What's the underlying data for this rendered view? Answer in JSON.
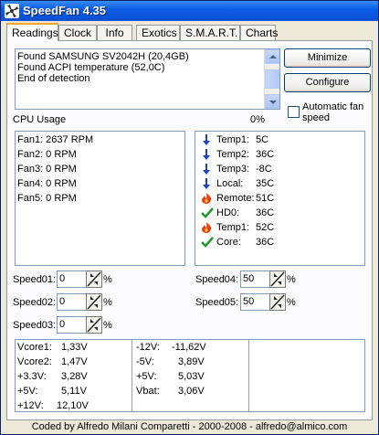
{
  "window": {
    "title": "SpeedFan 4.35"
  },
  "tabs": [
    "Readings",
    "Clock",
    "Info",
    "Exotics",
    "S.M.A.R.T.",
    "Charts"
  ],
  "log": {
    "lines": [
      "Found SAMSUNG SV2042H (20,4GB)",
      "Found ACPI temperature (52,0C)",
      "End of detection"
    ]
  },
  "buttons": {
    "minimize": "Minimize",
    "configure": "Configure"
  },
  "auto_fan": {
    "label_line1": "Automatic fan",
    "label_line2": "speed"
  },
  "cpu_usage": {
    "label": "CPU Usage",
    "value": "0%"
  },
  "fans": [
    "Fan1: 2637 RPM",
    "Fan2: 0 RPM",
    "Fan3: 0 RPM",
    "Fan4: 0 RPM",
    "Fan5: 0 RPM"
  ],
  "temps": [
    {
      "icon": "arrow-down-icon",
      "name": "Temp1:",
      "value": "5C"
    },
    {
      "icon": "arrow-down-icon",
      "name": "Temp2:",
      "value": "36C"
    },
    {
      "icon": "arrow-down-icon",
      "name": "Temp3:",
      "value": "-8C"
    },
    {
      "icon": "arrow-down-icon",
      "name": "Local:",
      "value": "35C"
    },
    {
      "icon": "flame-icon",
      "name": "Remote:",
      "value": "51C"
    },
    {
      "icon": "checkmark-icon",
      "name": "HD0:",
      "value": "36C"
    },
    {
      "icon": "flame-icon",
      "name": "Temp1:",
      "value": "52C"
    },
    {
      "icon": "checkmark-icon",
      "name": "Core:",
      "value": "36C"
    }
  ],
  "speeds": {
    "speed01": {
      "label": "Speed01:",
      "value": "0",
      "unit": "%"
    },
    "speed02": {
      "label": "Speed02:",
      "value": "0",
      "unit": "%"
    },
    "speed03": {
      "label": "Speed03:",
      "value": "0",
      "unit": "%"
    },
    "speed04": {
      "label": "Speed04:",
      "value": "50",
      "unit": "%"
    },
    "speed05": {
      "label": "Speed05:",
      "value": "50",
      "unit": "%"
    }
  },
  "voltages": {
    "col1": [
      {
        "name": "Vcore1:",
        "value": "1,33V"
      },
      {
        "name": "Vcore2:",
        "value": "1,47V"
      },
      {
        "name": "+3.3V:",
        "value": "3,28V"
      },
      {
        "name": "+5V:",
        "value": "5,11V"
      },
      {
        "name": "+12V:",
        "value": "12,10V"
      }
    ],
    "col2": [
      {
        "name": "-12V:",
        "value": "-11,62V"
      },
      {
        "name": "-5V:",
        "value": "3,89V"
      },
      {
        "name": "+5V:",
        "value": "5,03V"
      },
      {
        "name": "Vbat:",
        "value": "3,06V"
      }
    ]
  },
  "status_bar": "Coded by Alfredo Milani Comparetti - 2000-2008 - alfredo@almico.com",
  "colors": {
    "arrow": "#1a3fd0",
    "flame": "#e84010",
    "check": "#1c9a2a"
  }
}
